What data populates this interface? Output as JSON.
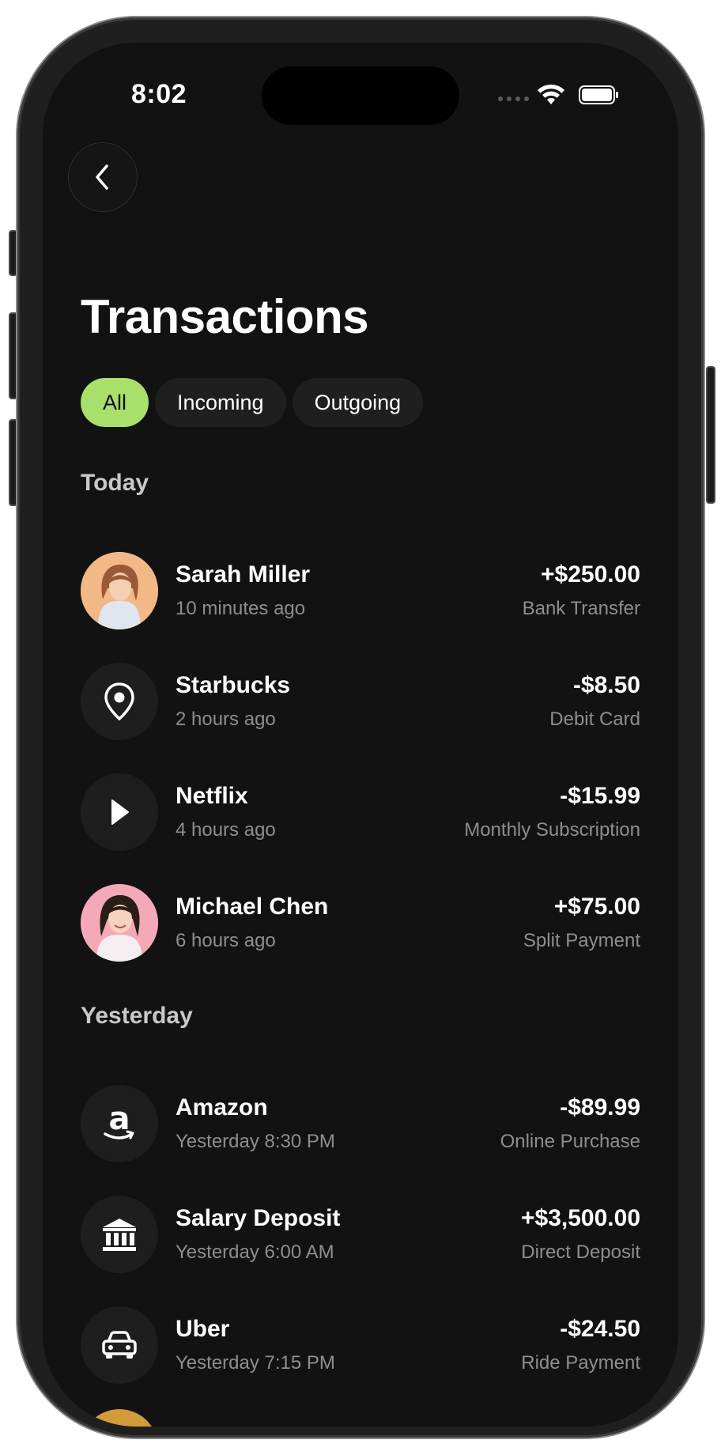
{
  "status_bar": {
    "time": "8:02"
  },
  "header": {
    "back_icon": "chevron-left-icon",
    "title": "Transactions"
  },
  "filters": [
    {
      "label": "All",
      "active": true
    },
    {
      "label": "Incoming",
      "active": false
    },
    {
      "label": "Outgoing",
      "active": false
    }
  ],
  "colors": {
    "accent": "#a8e06a",
    "background": "#121212",
    "card": "#1e1e1e",
    "secondary_text": "#8e8e8e"
  },
  "sections": [
    {
      "title": "Today",
      "transactions": [
        {
          "name": "Sarah Miller",
          "time": "10 minutes ago",
          "amount": "+$250.00",
          "method": "Bank Transfer",
          "icon": "avatar-photo"
        },
        {
          "name": "Starbucks",
          "time": "2 hours ago",
          "amount": "-$8.50",
          "method": "Debit Card",
          "icon": "location-pin-icon"
        },
        {
          "name": "Netflix",
          "time": "4 hours ago",
          "amount": "-$15.99",
          "method": "Monthly Subscription",
          "icon": "play-icon"
        },
        {
          "name": "Michael Chen",
          "time": "6 hours ago",
          "amount": "+$75.00",
          "method": "Split Payment",
          "icon": "avatar-photo"
        }
      ]
    },
    {
      "title": "Yesterday",
      "transactions": [
        {
          "name": "Amazon",
          "time": "Yesterday 8:30 PM",
          "amount": "-$89.99",
          "method": "Online Purchase",
          "icon": "amazon-logo-icon"
        },
        {
          "name": "Salary Deposit",
          "time": "Yesterday 6:00 AM",
          "amount": "+$3,500.00",
          "method": "Direct Deposit",
          "icon": "bank-icon"
        },
        {
          "name": "Uber",
          "time": "Yesterday 7:15 PM",
          "amount": "-$24.50",
          "method": "Ride Payment",
          "icon": "car-icon"
        }
      ]
    }
  ]
}
